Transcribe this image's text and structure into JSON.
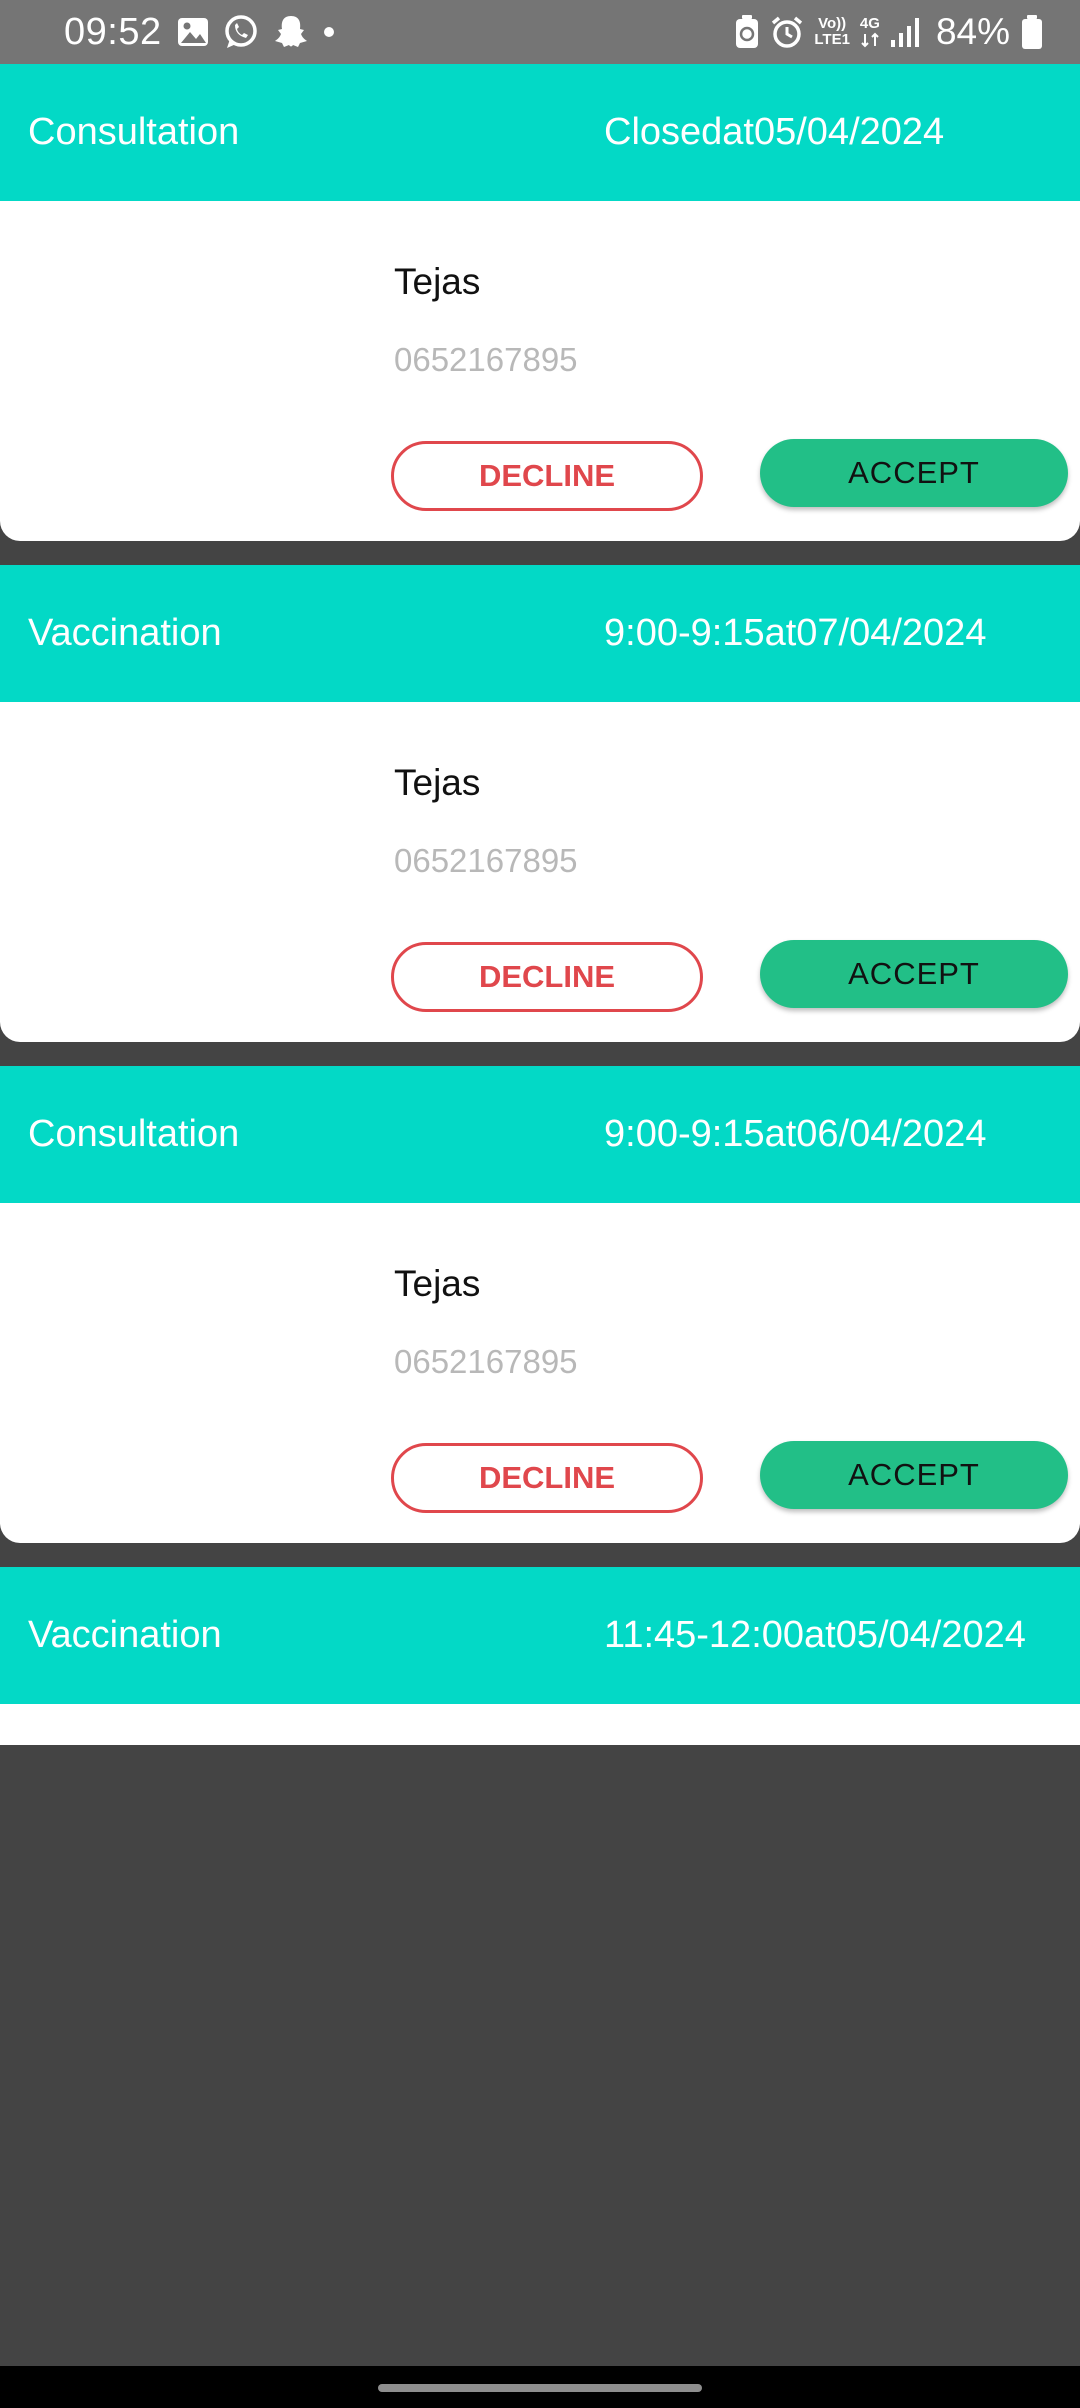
{
  "status_bar": {
    "time": "09:52",
    "left_icons": [
      "gallery-icon",
      "whatsapp-icon",
      "snapchat-icon",
      "dot-icon"
    ],
    "right_icons": [
      "battery-saver-icon",
      "alarm-icon",
      "volte-icon",
      "4g-icon",
      "signal-icon",
      "battery-icon"
    ],
    "volte_label_top": "Vo))",
    "volte_label_bottom": "LTE1",
    "net_label": "4G",
    "battery_percent": "84%"
  },
  "appointments": [
    {
      "title": "Consultation",
      "slot": "Closedat05/04/2024",
      "patient_name": "Tejas",
      "patient_phone": "0652167895",
      "decline_label": "DECLINE",
      "accept_label": "ACCEPT"
    },
    {
      "title": "Vaccination",
      "slot": "9:00-9:15at07/04/2024",
      "patient_name": "Tejas",
      "patient_phone": "0652167895",
      "decline_label": "DECLINE",
      "accept_label": "ACCEPT"
    },
    {
      "title": "Consultation",
      "slot": "9:00-9:15at06/04/2024",
      "patient_name": "Tejas",
      "patient_phone": "0652167895",
      "decline_label": "DECLINE",
      "accept_label": "ACCEPT"
    },
    {
      "title": "Vaccination",
      "slot": "11:45-12:00at05/04/2024"
    }
  ],
  "colors": {
    "header": "#03d9c6",
    "accept": "#22bf87",
    "decline": "#e0474c",
    "background": "#444444"
  }
}
